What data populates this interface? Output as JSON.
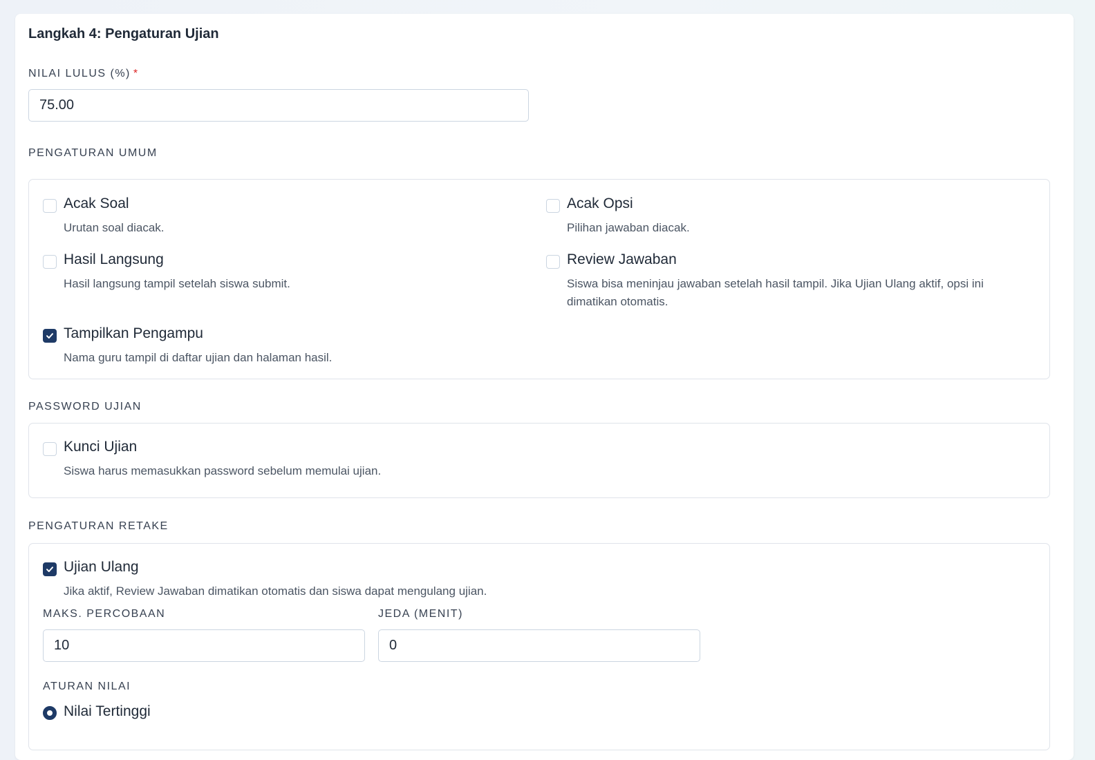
{
  "step_title": "Langkah 4: Pengaturan Ujian",
  "passing_grade": {
    "label": "NILAI LULUS (%)",
    "required_mark": "*",
    "value": "75.00"
  },
  "general_settings": {
    "heading": "PENGATURAN UMUM",
    "options": [
      {
        "title": "Acak Soal",
        "desc": "Urutan soal diacak.",
        "checked": false
      },
      {
        "title": "Acak Opsi",
        "desc": "Pilihan jawaban diacak.",
        "checked": false
      },
      {
        "title": "Hasil Langsung",
        "desc": "Hasil langsung tampil setelah siswa submit.",
        "checked": false
      },
      {
        "title": "Review Jawaban",
        "desc": "Siswa bisa meninjau jawaban setelah hasil tampil. Jika Ujian Ulang aktif, opsi ini dimatikan otomatis.",
        "checked": false
      },
      {
        "title": "Tampilkan Pengampu",
        "desc": "Nama guru tampil di daftar ujian dan halaman hasil.",
        "checked": true
      }
    ]
  },
  "password_settings": {
    "heading": "PASSWORD UJIAN",
    "option": {
      "title": "Kunci Ujian",
      "desc": "Siswa harus memasukkan password sebelum memulai ujian.",
      "checked": false
    }
  },
  "retake_settings": {
    "heading": "PENGATURAN RETAKE",
    "option": {
      "title": "Ujian Ulang",
      "desc": "Jika aktif, Review Jawaban dimatikan otomatis dan siswa dapat mengulang ujian.",
      "checked": true
    },
    "max_attempts": {
      "label": "MAKS. PERCOBAAN",
      "value": "10"
    },
    "cooldown": {
      "label": "JEDA (MENIT)",
      "value": "0"
    },
    "grading_rule": {
      "label": "ATURAN NILAI",
      "selected": "Nilai Tertinggi"
    }
  },
  "colors": {
    "accent": "#1e3a66",
    "required": "#dc2626",
    "border": "#cbd5e1"
  }
}
